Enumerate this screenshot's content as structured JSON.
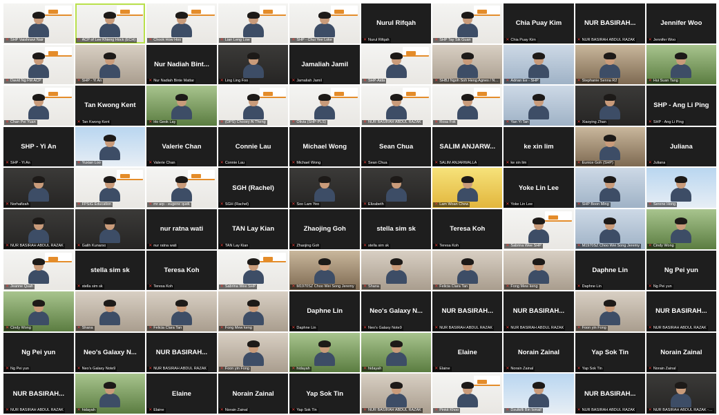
{
  "meeting": {
    "left_panel": [
      {
        "label": "SHP Vaishnavi Nair",
        "video": true,
        "bg": "banner"
      },
      {
        "label": "ACP of Lee Khieng Hock (ECH)",
        "video": true,
        "bg": "banner",
        "speaking": true
      },
      {
        "label": "Chook How Hoo",
        "video": true,
        "bg": "banner"
      },
      {
        "label": "Lian Leng Low",
        "video": true,
        "bg": "banner"
      },
      {
        "label": "SHP - Chui Yee Loke",
        "video": true,
        "bg": "banner"
      },
      {
        "label": "David Ng FM ACP",
        "video": true,
        "bg": "banner"
      },
      {
        "label": "SHP - Yi An",
        "video": true,
        "bg": "warm"
      },
      {
        "name": "Nur Nadiah Bint...",
        "label": "Nur Nadiah Binte Mattar",
        "video": false
      },
      {
        "label": "Ling Ling Foo",
        "video": true,
        "bg": "dark"
      },
      {
        "name": "Jamaliah Jamil",
        "label": "Jamaliah Jamil",
        "video": false
      },
      {
        "label": "Chan Pei Yuan",
        "video": true,
        "bg": "banner"
      },
      {
        "name": "Tan Kwong Kent",
        "label": "Tan Kwong Kent",
        "video": false
      },
      {
        "label": "Ho Geok Lay",
        "video": true,
        "bg": "green"
      },
      {
        "label": "(OPS) Chooey Ai Theng",
        "video": true,
        "bg": "banner"
      },
      {
        "label": "Olivia (SHP-PLS)",
        "video": true,
        "bg": "banner"
      },
      {
        "name": "SHP - Yi An",
        "label": "SHP - Yi An",
        "video": false
      },
      {
        "label": "Yuxian Loo",
        "video": true,
        "bg": "sky"
      },
      {
        "name": "Valerie Chan",
        "label": "Valerie Chan",
        "video": false
      },
      {
        "name": "Connie Lau",
        "label": "Connie Lau",
        "video": false
      },
      {
        "name": "Michael Wong",
        "label": "Michael Wong",
        "video": false
      },
      {
        "label": "Norhafizah",
        "video": true,
        "bg": "dark"
      },
      {
        "label": "FPSIG Education",
        "video": true,
        "bg": "banner"
      },
      {
        "label": "mr arp - eugene quek",
        "video": true,
        "bg": "banner"
      },
      {
        "name": "SGH (Rachel)",
        "label": "SGH (Rachel)",
        "video": false
      },
      {
        "label": "Soo Lam Yeo",
        "video": true,
        "bg": "dark"
      },
      {
        "label": "NUR BASIRAH ABDUL RAZAK",
        "video": true,
        "bg": "dark"
      },
      {
        "label": "Galih Kunarso",
        "video": true,
        "bg": "dark"
      },
      {
        "name": "nur ratna wati",
        "label": "nur ratna wati",
        "video": false
      },
      {
        "name": "TAN Lay Kian",
        "label": "TAN Lay Kian",
        "video": false
      },
      {
        "name": "Zhaojing Goh",
        "label": "Zhaojing Goh",
        "video": false
      },
      {
        "label": "Jeanne Quah",
        "video": true,
        "bg": "banner"
      },
      {
        "name": "stella sim sk",
        "label": "stella sim sk",
        "video": false
      },
      {
        "name": "Teresa Koh",
        "label": "Teresa Koh",
        "video": false
      },
      {
        "label": "Sabrina Wee SHP",
        "video": true,
        "bg": "banner"
      },
      {
        "label": "M1970SZ Choo Wei Song Jeremy",
        "video": true,
        "bg": "room"
      },
      {
        "label": "Cindy Wong",
        "video": true,
        "bg": "green"
      },
      {
        "label": "Shana",
        "video": true,
        "bg": "warm"
      },
      {
        "label": "Felicia Clara Tan",
        "video": true,
        "bg": "warm"
      },
      {
        "label": "Fong Mew keng",
        "video": true,
        "bg": "warm"
      },
      {
        "name": "Daphne Lin",
        "label": "Daphne Lin",
        "video": false
      },
      {
        "name": "Ng Pei yun",
        "label": "Ng Pei yun",
        "video": false
      },
      {
        "name": "Neo's Galaxy N...",
        "label": "Neo's Galaxy Note9",
        "video": false
      },
      {
        "name": "NUR BASIRAH...",
        "label": "NUR BASIRAH ABDUL RAZAK",
        "video": false
      },
      {
        "label": "Foon yin Fong",
        "video": true,
        "bg": "warm"
      },
      {
        "label": "hidayah",
        "video": true,
        "bg": "green"
      },
      {
        "name": "NUR BASIRAH...",
        "label": "NUR BASIRAH ABDUL RAZAK",
        "video": false
      },
      {
        "label": "hidayah",
        "video": true,
        "bg": "green"
      },
      {
        "name": "Elaine",
        "label": "Elaine",
        "video": false
      },
      {
        "name": "Norain Zainal",
        "label": "Norain Zainal",
        "video": false
      },
      {
        "name": "Yap Sok Tin",
        "label": "Yap Sok Tin",
        "video": false
      }
    ],
    "right_panel": [
      {
        "name": "Nurul Rifqah",
        "label": "Nurul Rifqah",
        "video": false
      },
      {
        "label": "SHP Tay Sik Guan",
        "video": true,
        "bg": "banner"
      },
      {
        "name": "Chia Puay Kim",
        "label": "Chia Puay Kim",
        "video": false
      },
      {
        "name": "NUR BASIRAH...",
        "label": "NUR BASIRAH ABDUL RAZAK",
        "video": false
      },
      {
        "name": "Jennifer Woo",
        "label": "Jennifer Woo",
        "video": false
      },
      {
        "label": "SHP-Aida",
        "video": true,
        "bg": "banner"
      },
      {
        "label": "SHBJ Ngoh Soh Heng Agnes / N6...",
        "video": true,
        "bg": "warm"
      },
      {
        "label": "Adrian Ee - SHP",
        "video": true,
        "bg": "cool"
      },
      {
        "label": "Stephanie Senna R2",
        "video": true,
        "bg": "room"
      },
      {
        "label": "Hui Suan Tang",
        "video": true,
        "bg": "green"
      },
      {
        "label": "NUR BASIRAH ABDUL RAZAK",
        "video": true,
        "bg": "banner"
      },
      {
        "label": "Rosa Fok",
        "video": true,
        "bg": "banner"
      },
      {
        "label": "Yan Yi Tan",
        "video": true,
        "bg": "cool"
      },
      {
        "label": "Xiaoying Zhan",
        "video": true,
        "bg": "dark"
      },
      {
        "name": "SHP - Ang Li Ping",
        "label": "SHP - Ang Li Ping",
        "video": false
      },
      {
        "name": "Sean Chua",
        "label": "Sean Chua",
        "video": false
      },
      {
        "name": "SALIM ANJARW...",
        "label": "SALIM ANJARWALLA",
        "video": false
      },
      {
        "name": "ke xin lim",
        "label": "ke xin lim",
        "video": false
      },
      {
        "label": "Eunice Goh (SHP)",
        "video": true,
        "bg": "room"
      },
      {
        "name": "Juliana",
        "label": "Juliana",
        "video": false
      },
      {
        "label": "Elizabeth",
        "video": true,
        "bg": "dark"
      },
      {
        "label": "Lam Woan Chew",
        "video": true,
        "bg": "yellow"
      },
      {
        "name": "Yoke Lin Lee",
        "label": "Yoke Lin Lee",
        "video": false
      },
      {
        "label": "SHP Boon Ming",
        "video": true,
        "bg": "cool"
      },
      {
        "label": "Serene Hong",
        "video": true,
        "bg": "sky"
      },
      {
        "name": "stella sim sk",
        "label": "stella sim sk",
        "video": false
      },
      {
        "name": "Teresa Koh",
        "label": "Teresa Koh",
        "video": false
      },
      {
        "label": "Sabrina Wee SHP",
        "video": true,
        "bg": "banner"
      },
      {
        "label": "M1970SZ Choo Wei Song Jeremy",
        "video": true,
        "bg": "cool"
      },
      {
        "label": "Cindy Wong",
        "video": true,
        "bg": "green"
      },
      {
        "label": "Shana",
        "video": true,
        "bg": "warm"
      },
      {
        "label": "Felicia Clara Tan",
        "video": true,
        "bg": "warm"
      },
      {
        "label": "Fong Mew keng",
        "video": true,
        "bg": "warm"
      },
      {
        "name": "Daphne Lin",
        "label": "Daphne Lin",
        "video": false
      },
      {
        "name": "Ng Pei yun",
        "label": "Ng Pei yun",
        "video": false
      },
      {
        "name": "Neo's Galaxy N...",
        "label": "Neo's Galaxy Note9",
        "video": false
      },
      {
        "name": "NUR BASIRAH...",
        "label": "NUR BASIRAH ABDUL RAZAK",
        "video": false
      },
      {
        "name": "NUR BASIRAH...",
        "label": "NUR BASIRAH ABDUL RAZAK",
        "video": false
      },
      {
        "label": "Foon yin Fong",
        "video": true,
        "bg": "warm"
      },
      {
        "name": "NUR BASIRAH...",
        "label": "NUR BASIRAH ABDUL RAZAK",
        "video": false
      },
      {
        "label": "hidayah",
        "video": true,
        "bg": "green"
      },
      {
        "name": "Elaine",
        "label": "Elaine",
        "video": false
      },
      {
        "name": "Norain Zainal",
        "label": "Norain Zainal",
        "video": false
      },
      {
        "name": "Yap Sok Tin",
        "label": "Yap Sok Tin",
        "video": false
      },
      {
        "name": "Norain Zainal",
        "label": "Norain Zainal",
        "video": false
      },
      {
        "label": "NUR BASIRAH ABDUL RAZAK",
        "video": true,
        "bg": "warm"
      },
      {
        "label": "Pinkit Khoo",
        "video": true,
        "bg": "banner"
      },
      {
        "label": "Dzulkifli Bin Ismail",
        "video": true,
        "bg": "sky"
      },
      {
        "name": "NUR BASIRAH...",
        "label": "NUR BASIRAH ABDUL RAZAK",
        "video": false
      },
      {
        "label": "NUR BASIRAH ABDUL RAZAK - chip",
        "video": true,
        "bg": "dark"
      }
    ]
  }
}
